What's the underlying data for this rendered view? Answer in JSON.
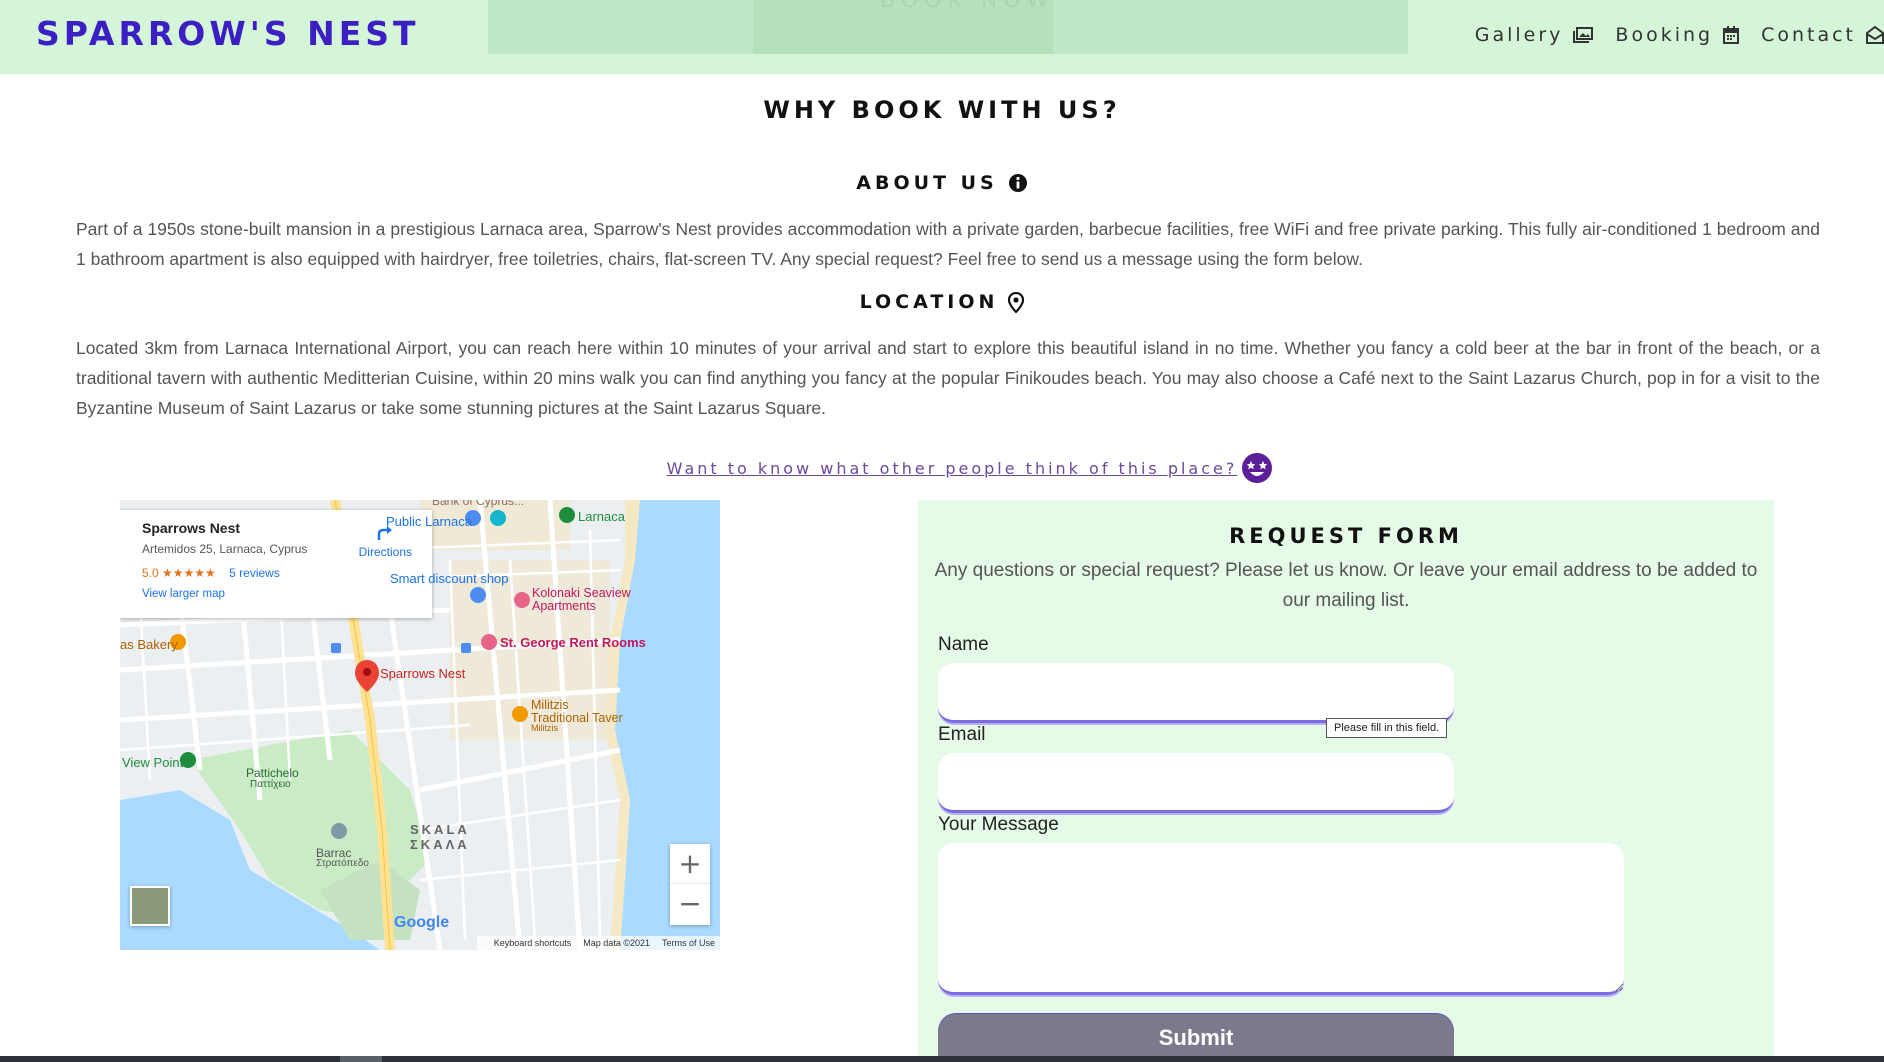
{
  "header": {
    "brand": "SPARROW'S NEST",
    "hero_ghost_text": "BOOK NOW",
    "nav": [
      {
        "label": "Gallery",
        "icon": "gallery-icon"
      },
      {
        "label": "Booking",
        "icon": "calendar-icon"
      },
      {
        "label": "Contact",
        "icon": "envelope-icon"
      }
    ]
  },
  "why": {
    "title": "WHY BOOK WITH US?",
    "about_title": "ABOUT US",
    "about_text": "Part of a 1950s stone-built mansion in a prestigious Larnaca area, Sparrow's Nest provides accommodation with a private garden, barbecue facilities, free WiFi and free private parking. This fully air-conditioned 1 bedroom and 1 bathroom apartment is also equipped with hairdryer, free toiletries, chairs, flat-screen TV. Any special request? Feel free to send us a message using the form below.",
    "location_title": "LOCATION",
    "location_text": "Located 3km from Larnaca International Airport, you can reach here within 10 minutes of your arrival and start to explore this beautiful island in no time. Whether you fancy a cold beer at the bar in front of the beach, or a traditional tavern with authentic Meditterian Cuisine, within 20 mins walk you can find anything you fancy at the popular Finikoudes beach. You may also choose a Café next to the Saint Lazarus Church, pop in for a visit to the Byzantine Museum of Saint Lazarus or take some stunning pictures at the Saint Lazarus Square.",
    "reviews_link": "Want to know what other people think of this place?"
  },
  "map": {
    "place_name": "Sparrows Nest",
    "address": "Artemidos 25, Larnaca, Cyprus",
    "rating": "5.0 ★★★★★",
    "reviews": "5 reviews",
    "larger_map": "View larger map",
    "directions": "Directions",
    "labels": {
      "bank": "Bank of Cyprus...",
      "public_larnaca": "Public Larnaca",
      "larnaca": "Larnaca",
      "smart_discount": "Smart discount shop",
      "kolonaki_1": "Kolonaki Seaview",
      "kolonaki_2": "Apartments",
      "st_george": "St. George Rent Rooms",
      "bakery": "as Bakery",
      "sparrows": "Sparrows Nest",
      "militzis_1": "Militzis",
      "militzis_2": "Traditional Taver",
      "militzis_3": "Militzis",
      "view_point": "View Point",
      "pattiche_1": "Pattichelo",
      "pattiche_2": "Παττίχειο",
      "skala_1": "SKALA",
      "skala_2": "ΣΚΑΛΑ",
      "barracks_1": "Barrac",
      "barracks_2": "Στρατόπεδο",
      "google": "Google"
    },
    "zoom_in": "+",
    "zoom_out": "−",
    "footer": {
      "shortcuts": "Keyboard shortcuts",
      "data": "Map data ©2021",
      "terms": "Terms of Use"
    }
  },
  "form": {
    "title": "REQUEST FORM",
    "description": "Any questions or special request? Please let us know. Or leave your email address to be added to our mailing list.",
    "name_label": "Name",
    "email_label": "Email",
    "message_label": "Your Message",
    "tooltip": "Please fill in this field.",
    "submit": "Submit"
  },
  "colors": {
    "brand": "#3b1fc2",
    "header_bg": "#d4f5d8",
    "form_bg": "#e6fae8",
    "input_border": "#7b6be0",
    "submit_bg": "#7a7a8c",
    "link": "#6a4a9a",
    "emoji": "#5b1f9a"
  }
}
